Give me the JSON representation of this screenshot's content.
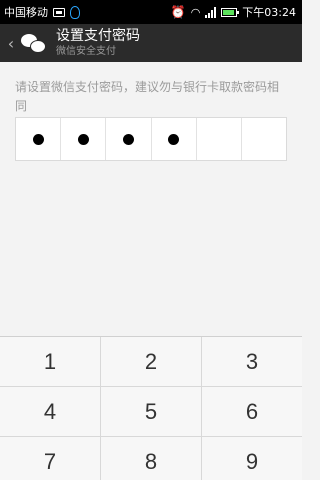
{
  "status_bar": {
    "carrier": "中国移动",
    "time": "下午03:24",
    "icons": [
      "image-icon",
      "qq-icon",
      "alarm-icon",
      "wifi-icon",
      "signal-icon",
      "battery-icon"
    ]
  },
  "title_bar": {
    "back_icon": "chevron-left-icon",
    "app_icon": "wechat-icon",
    "title": "设置支付密码",
    "subtitle": "微信安全支付"
  },
  "content": {
    "hint": "请设置微信支付密码，建议勿与银行卡取款密码相同",
    "pin": {
      "length": 6,
      "filled": 4
    }
  },
  "keypad": {
    "rows": [
      [
        "1",
        "2",
        "3"
      ],
      [
        "4",
        "5",
        "6"
      ],
      [
        "7",
        "8",
        "9"
      ]
    ]
  },
  "colors": {
    "status_bar_bg": "#000000",
    "title_bar_bg": "#2b2b2b",
    "page_bg": "#f3f3f3",
    "hint_text": "#9b9b9b",
    "battery_fill": "#5be05b"
  }
}
